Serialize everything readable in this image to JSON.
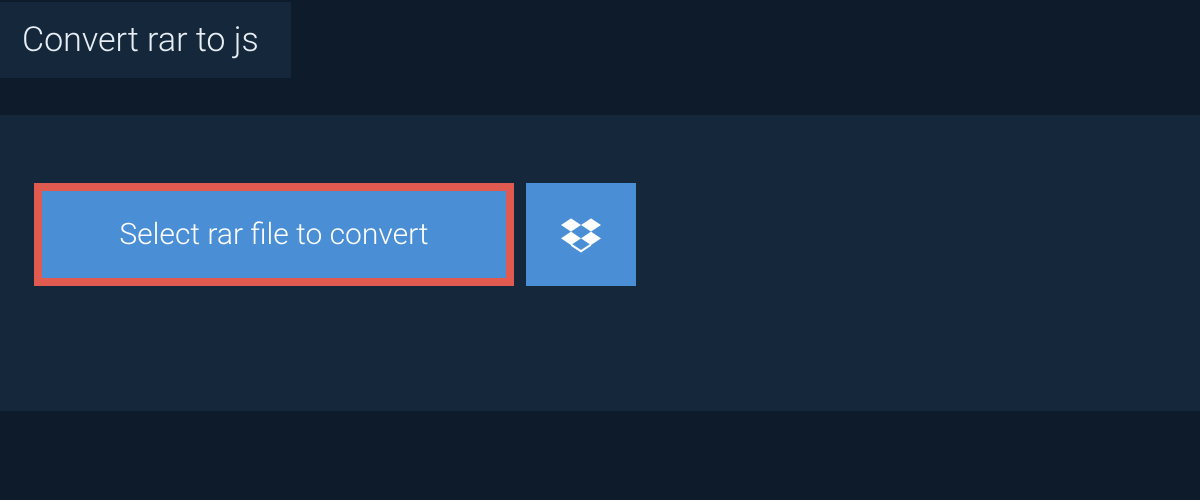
{
  "tab": {
    "title": "Convert rar to js"
  },
  "actions": {
    "select_label": "Select rar file to convert",
    "dropbox_icon": "dropbox-icon"
  },
  "colors": {
    "background": "#0d1b2a",
    "panel": "#14273b",
    "button": "#4a8fd6",
    "highlight_border": "#e05a4f"
  }
}
